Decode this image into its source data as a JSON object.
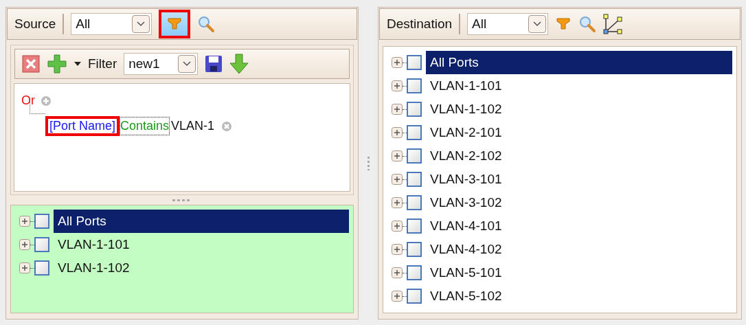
{
  "source": {
    "label": "Source",
    "scope": "All",
    "filter_button": {
      "highlighted": true
    },
    "filter_bar": {
      "label": "Filter",
      "value": "new1"
    },
    "expression": {
      "operator": "Or",
      "condition": {
        "field": "[Port Name]",
        "field_highlighted": true,
        "comparison": "Contains",
        "value": "VLAN-1"
      }
    },
    "tree": [
      {
        "label": "All Ports",
        "selected": true,
        "checked": false,
        "expanded": false
      },
      {
        "label": "VLAN-1-101",
        "selected": false,
        "checked": false,
        "expanded": false
      },
      {
        "label": "VLAN-1-102",
        "selected": false,
        "checked": false,
        "expanded": false
      }
    ]
  },
  "destination": {
    "label": "Destination",
    "scope": "All",
    "tree": [
      {
        "label": "All Ports",
        "selected": true,
        "checked": false,
        "expanded": false
      },
      {
        "label": "VLAN-1-101",
        "selected": false,
        "checked": false,
        "expanded": false
      },
      {
        "label": "VLAN-1-102",
        "selected": false,
        "checked": false,
        "expanded": false
      },
      {
        "label": "VLAN-2-101",
        "selected": false,
        "checked": false,
        "expanded": false
      },
      {
        "label": "VLAN-2-102",
        "selected": false,
        "checked": false,
        "expanded": false
      },
      {
        "label": "VLAN-3-101",
        "selected": false,
        "checked": false,
        "expanded": false
      },
      {
        "label": "VLAN-3-102",
        "selected": false,
        "checked": false,
        "expanded": false
      },
      {
        "label": "VLAN-4-101",
        "selected": false,
        "checked": false,
        "expanded": false
      },
      {
        "label": "VLAN-4-102",
        "selected": false,
        "checked": false,
        "expanded": false
      },
      {
        "label": "VLAN-5-101",
        "selected": false,
        "checked": false,
        "expanded": false
      },
      {
        "label": "VLAN-5-102",
        "selected": false,
        "checked": false,
        "expanded": false
      }
    ]
  }
}
